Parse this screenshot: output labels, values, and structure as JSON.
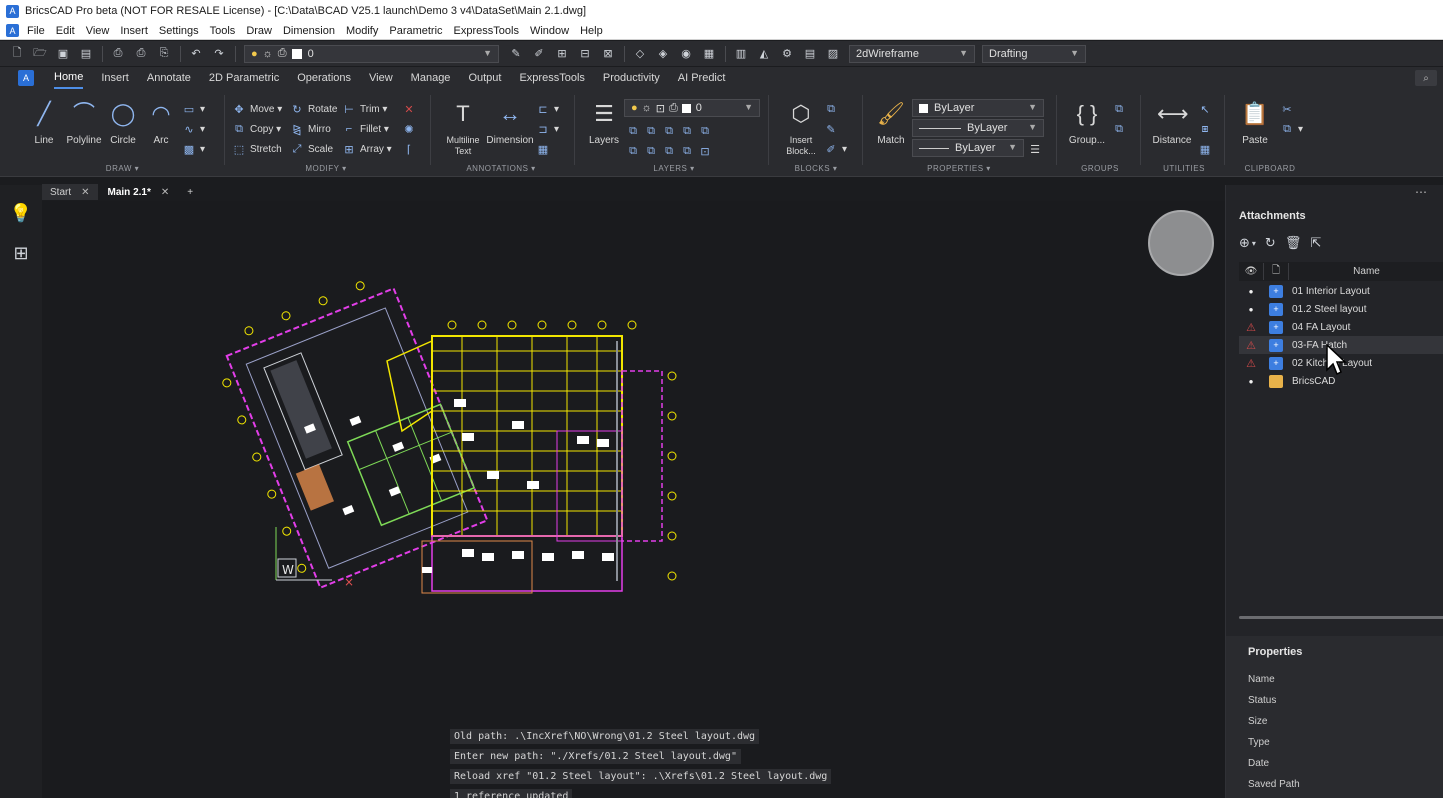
{
  "window": {
    "title": "BricsCAD Pro beta (NOT FOR RESALE License) - [C:\\Data\\BCAD V25.1 launch\\Demo 3 v4\\DataSet\\Main 2.1.dwg]"
  },
  "menu": [
    "File",
    "Edit",
    "View",
    "Insert",
    "Settings",
    "Tools",
    "Draw",
    "Dimension",
    "Modify",
    "Parametric",
    "ExpressTools",
    "Window",
    "Help"
  ],
  "qat": {
    "layer_value": "0",
    "visual_style": "2dWireframe",
    "workspace": "Drafting"
  },
  "ribbon_tabs": [
    {
      "label": "Home",
      "active": true
    },
    {
      "label": "Insert"
    },
    {
      "label": "Annotate"
    },
    {
      "label": "2D Parametric"
    },
    {
      "label": "Operations"
    },
    {
      "label": "View"
    },
    {
      "label": "Manage"
    },
    {
      "label": "Output"
    },
    {
      "label": "ExpressTools"
    },
    {
      "label": "Productivity"
    },
    {
      "label": "AI Predict"
    }
  ],
  "ribbon": {
    "draw": {
      "title": "DRAW ▾",
      "line": "Line",
      "polyline": "Polyline",
      "circle": "Circle",
      "arc": "Arc"
    },
    "modify": {
      "title": "MODIFY ▾",
      "move": "Move",
      "rotate": "Rotate",
      "trim": "Trim",
      "copy": "Copy",
      "mirror": "Mirro",
      "fillet": "Fillet",
      "stretch": "Stretch",
      "scale": "Scale",
      "array": "Array"
    },
    "annotations": {
      "title": "ANNOTATIONS ▾",
      "mtext": "Multiline Text",
      "dimension": "Dimension"
    },
    "layers": {
      "title": "LAYERS ▾",
      "layers": "Layers",
      "current_layer": "0"
    },
    "blocks": {
      "title": "BLOCKS ▾",
      "insert": "Insert Block..."
    },
    "properties": {
      "title": "PROPERTIES ▾",
      "match": "Match",
      "color": "ByLayer",
      "linetype": "ByLayer",
      "lineweight": "ByLayer"
    },
    "groups": {
      "title": "GROUPS",
      "group": "Group..."
    },
    "utilities": {
      "title": "UTILITIES",
      "distance": "Distance"
    },
    "clipboard": {
      "title": "CLIPBOARD",
      "paste": "Paste"
    }
  },
  "doc_tabs": [
    {
      "label": "Start",
      "active": false
    },
    {
      "label": "Main 2.1*",
      "active": true
    }
  ],
  "command_log": [
    "Old path: .\\IncXref\\NO\\Wrong\\01.2 Steel layout.dwg",
    "Enter new path: \"./Xrefs/01.2 Steel layout.dwg\"",
    "Reload xref \"01.2 Steel layout\": .\\Xrefs\\01.2 Steel layout.dwg",
    "1 reference updated"
  ],
  "ucs_label": "W",
  "attachments": {
    "title": "Attachments",
    "header_name": "Name",
    "items": [
      {
        "name": "01 Interior Layout",
        "status": "loaded",
        "type": "dwg"
      },
      {
        "name": "01.2 Steel layout",
        "status": "loaded",
        "type": "dwg"
      },
      {
        "name": "04 FA Layout",
        "status": "warning",
        "type": "dwg"
      },
      {
        "name": "03-FA Hatch",
        "status": "warning",
        "type": "dwg"
      },
      {
        "name": "02 Kitchen Layout",
        "status": "warning",
        "type": "dwg"
      },
      {
        "name": "BricsCAD",
        "status": "loaded",
        "type": "folder"
      }
    ]
  },
  "properties": {
    "title": "Properties",
    "rows": [
      "Name",
      "Status",
      "Size",
      "Type",
      "Date",
      "Saved Path"
    ]
  },
  "colors": {
    "accent": "#4e8fe8",
    "warning": "#d14a4a",
    "drawing_yellow": "#f2e600",
    "drawing_magenta": "#e23ee8",
    "drawing_green": "#7ed957"
  }
}
